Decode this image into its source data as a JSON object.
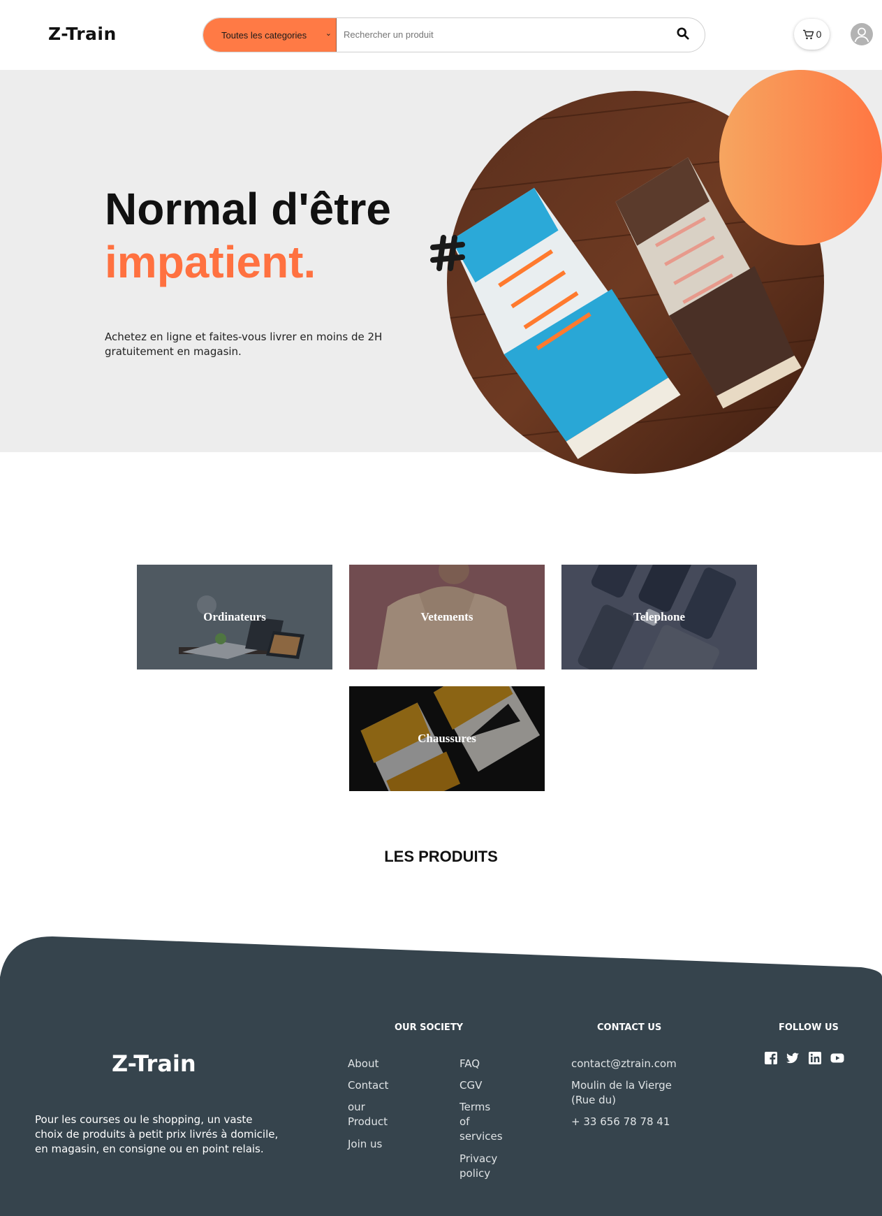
{
  "header": {
    "logo": "Z-Train",
    "category_select": "Toutes les categories",
    "search_placeholder": "Rechercher un produit",
    "cart_count": "0"
  },
  "hero": {
    "title_line1": "Normal d'être",
    "title_line2": "impatient.",
    "description": "Achetez en ligne et faites-vous livrer en moins de 2H gratuitement en magasin."
  },
  "categories": [
    {
      "label": "Ordinateurs"
    },
    {
      "label": "Vetements"
    },
    {
      "label": "Telephone"
    },
    {
      "label": "Chaussures"
    }
  ],
  "products_title": "LES PRODUITS",
  "footer": {
    "logo": "Z-Train",
    "description": "Pour les courses ou le shopping, un vaste choix de produits à petit prix livrés à domicile, en magasin, en consigne ou en point relais.",
    "society": {
      "heading": "OUR SOCIETY",
      "col1": [
        "About",
        "Contact",
        "our Product",
        "Join us"
      ],
      "col2": [
        "FAQ",
        "CGV",
        "Terms of services",
        "Privacy policy"
      ]
    },
    "contact": {
      "heading": "CONTACT US",
      "email": "contact@ztrain.com",
      "address": "Moulin de la Vierge (Rue du)",
      "phone": "+ 33 656 78 78 41"
    },
    "follow": {
      "heading": "FOLLOW US",
      "icons": [
        "facebook-icon",
        "twitter-icon",
        "linkedin-icon",
        "youtube-icon"
      ]
    }
  },
  "colors": {
    "accent": "#ff7140",
    "footer_bg": "#36444d",
    "hero_bg": "#ededed"
  }
}
